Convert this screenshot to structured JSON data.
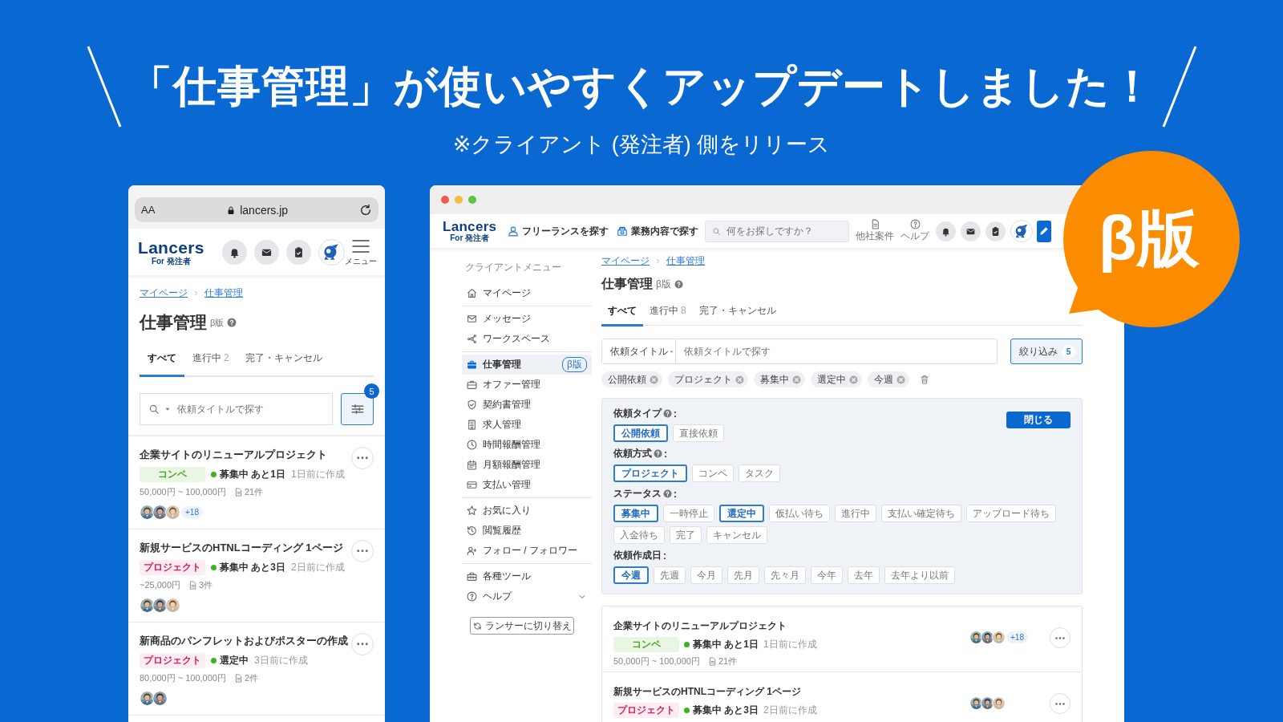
{
  "headline": "「仕事管理」が使いやすくアップデートしました！",
  "subheadline": "※クライアント (発注者) 側をリリース",
  "badge": "β版",
  "mobile": {
    "browser": {
      "text_size": "AA",
      "url": "lancers.jp"
    },
    "logo": {
      "name": "Lancers",
      "sub": "For 発注者"
    },
    "menu_label": "メニュー",
    "breadcrumb": [
      "マイページ",
      "仕事管理"
    ],
    "title": "仕事管理",
    "title_tag": "β版",
    "tabs": [
      {
        "label": "すべて",
        "selected": true
      },
      {
        "label": "進行中",
        "count": "2",
        "selected": false
      },
      {
        "label": "完了・キャンセル",
        "selected": false
      }
    ],
    "search": {
      "placeholder": "依頼タイトルで探す"
    },
    "filter_count": "5",
    "jobs": [
      {
        "title": "企業サイトのリニューアルプロジェクト",
        "type": {
          "kind": "contest",
          "label": "コンペ"
        },
        "status": "募集中 あと1日",
        "created": "1日前に作成",
        "budget": "50,000円 ~ 100,000円",
        "proposals": "21件",
        "more": "+18"
      },
      {
        "title": "新規サービスのHTNLコーディング 1ページ",
        "type": {
          "kind": "project",
          "label": "プロジェクト"
        },
        "status": "募集中 あと3日",
        "created": "2日前に作成",
        "budget": "~25,000円",
        "proposals": "3件"
      },
      {
        "title": "新商品のパンフレットおよびポスターの作成",
        "type": {
          "kind": "project",
          "label": "プロジェクト"
        },
        "status": "選定中",
        "created": "3日前に作成",
        "budget": "80,000円 ~ 100,000円",
        "proposals": "2件"
      }
    ]
  },
  "desktop": {
    "logo": {
      "name": "Lancers",
      "sub": "For 発注者"
    },
    "nav": [
      "フリーランスを探す",
      "業務内容で探す"
    ],
    "search": {
      "placeholder": "何をお探しですか？"
    },
    "tools": [
      "他社案件",
      "ヘルプ"
    ],
    "sidebar": {
      "heading": "クライアントメニュー",
      "groups": [
        [
          {
            "label": "マイページ",
            "kind": "link",
            "selected": false
          }
        ],
        [
          {
            "label": "メッセージ",
            "kind": "link",
            "selected": false
          },
          {
            "label": "ワークスペース",
            "kind": "link",
            "selected": false
          }
        ],
        [
          {
            "label": "仕事管理",
            "kind": "link",
            "selected": true,
            "tag": "β版"
          },
          {
            "label": "オファー管理",
            "kind": "link",
            "selected": false
          },
          {
            "label": "契約書管理",
            "kind": "link",
            "selected": false
          },
          {
            "label": "求人管理",
            "kind": "link",
            "selected": false
          },
          {
            "label": "時間報酬管理",
            "kind": "link",
            "selected": false
          },
          {
            "label": "月額報酬管理",
            "kind": "link",
            "selected": false
          },
          {
            "label": "支払い管理",
            "kind": "link",
            "selected": false
          }
        ],
        [
          {
            "label": "お気に入り",
            "kind": "link",
            "selected": false
          },
          {
            "label": "閲覧履歴",
            "kind": "link",
            "selected": false
          },
          {
            "label": "フォロー / フォロワー",
            "kind": "link",
            "selected": false
          }
        ],
        [
          {
            "label": "各種ツール",
            "kind": "link",
            "selected": false
          },
          {
            "label": "ヘルプ",
            "kind": "dropdown",
            "selected": false
          }
        ]
      ],
      "switch_button": "ランサーに切り替え"
    },
    "breadcrumb": [
      "マイページ",
      "仕事管理"
    ],
    "title": "仕事管理",
    "title_tag": "β版",
    "tabs": [
      {
        "label": "すべて",
        "selected": true
      },
      {
        "label": "進行中",
        "count": "8",
        "selected": false
      },
      {
        "label": "完了・キャンセル",
        "selected": false
      }
    ],
    "search_scope": "依頼タイトル",
    "search_placeholder": "依頼タイトルで探す",
    "filter_button": {
      "label": "絞り込み",
      "count": "5"
    },
    "active_filters": [
      "公開依頼",
      "プロジェクト",
      "募集中",
      "選定中",
      "今週"
    ],
    "filter_panel": {
      "close_button": "閉じる",
      "groups": [
        {
          "label": "依頼タイプ",
          "help": true,
          "colon": ":",
          "options": [
            {
              "label": "公開依頼",
              "selected": true
            },
            {
              "label": "直接依頼",
              "selected": false
            }
          ]
        },
        {
          "label": "依頼方式",
          "help": true,
          "colon": ":",
          "options": [
            {
              "label": "プロジェクト",
              "selected": true
            },
            {
              "label": "コンペ",
              "selected": false
            },
            {
              "label": "タスク",
              "selected": false
            }
          ]
        },
        {
          "label": "ステータス",
          "help": true,
          "colon": ":",
          "options": [
            {
              "label": "募集中",
              "selected": true
            },
            {
              "label": "一時停止",
              "selected": false
            },
            {
              "label": "選定中",
              "selected": true
            },
            {
              "label": "仮払い待ち",
              "selected": false
            },
            {
              "label": "進行中",
              "selected": false
            },
            {
              "label": "支払い確定待ち",
              "selected": false
            },
            {
              "label": "アップロード待ち",
              "selected": false
            },
            {
              "label": "入金待ち",
              "selected": false
            },
            {
              "label": "完了",
              "selected": false
            },
            {
              "label": "キャンセル",
              "selected": false
            }
          ]
        },
        {
          "label": "依頼作成日",
          "help": false,
          "colon": ":",
          "options": [
            {
              "label": "今週",
              "selected": true
            },
            {
              "label": "先週",
              "selected": false
            },
            {
              "label": "今月",
              "selected": false
            },
            {
              "label": "先月",
              "selected": false
            },
            {
              "label": "先々月",
              "selected": false
            },
            {
              "label": "今年",
              "selected": false
            },
            {
              "label": "去年",
              "selected": false
            },
            {
              "label": "去年より以前",
              "selected": false
            }
          ]
        }
      ]
    },
    "jobs": [
      {
        "title": "企業サイトのリニューアルプロジェクト",
        "type": {
          "kind": "contest",
          "label": "コンペ"
        },
        "status": "募集中 あと1日",
        "created": "1日前に作成",
        "budget": "50,000円 ~ 100,000円",
        "proposals": "21件",
        "more": "+18"
      },
      {
        "title": "新規サービスのHTNLコーディング 1ページ",
        "type": {
          "kind": "project",
          "label": "プロジェクト"
        },
        "status": "募集中 あと3日",
        "created": "2日前に作成"
      }
    ]
  }
}
